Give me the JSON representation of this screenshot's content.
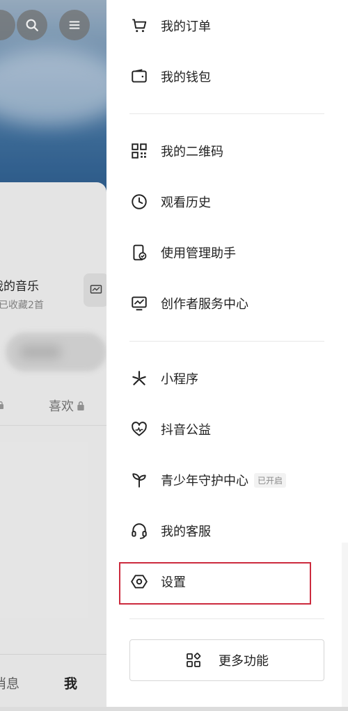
{
  "background": {
    "music_title": "我的音乐",
    "music_subtitle": "已收藏2首",
    "like_tab": "喜欢",
    "nav_message": "消息",
    "nav_me": "我"
  },
  "drawer": {
    "groups": [
      {
        "items": [
          {
            "label": "我的订单",
            "icon": "cart-icon"
          },
          {
            "label": "我的钱包",
            "icon": "wallet-icon"
          }
        ]
      },
      {
        "items": [
          {
            "label": "我的二维码",
            "icon": "qr-code-icon"
          },
          {
            "label": "观看历史",
            "icon": "clock-icon"
          },
          {
            "label": "使用管理助手",
            "icon": "phone-check-icon"
          },
          {
            "label": "创作者服务中心",
            "icon": "monitor-chart-icon"
          }
        ]
      },
      {
        "items": [
          {
            "label": "小程序",
            "icon": "mini-program-icon"
          },
          {
            "label": "抖音公益",
            "icon": "heart-charity-icon"
          },
          {
            "label": "青少年守护中心",
            "icon": "sprout-icon",
            "badge": "已开启"
          },
          {
            "label": "我的客服",
            "icon": "headset-icon"
          },
          {
            "label": "设置",
            "icon": "settings-hexagon-icon",
            "highlighted": true
          }
        ]
      }
    ],
    "more_button": {
      "label": "更多功能",
      "icon": "apps-grid-icon"
    }
  },
  "colors": {
    "highlight": "#cc2a3d",
    "text": "#222222",
    "divider": "#e8e8e8"
  }
}
